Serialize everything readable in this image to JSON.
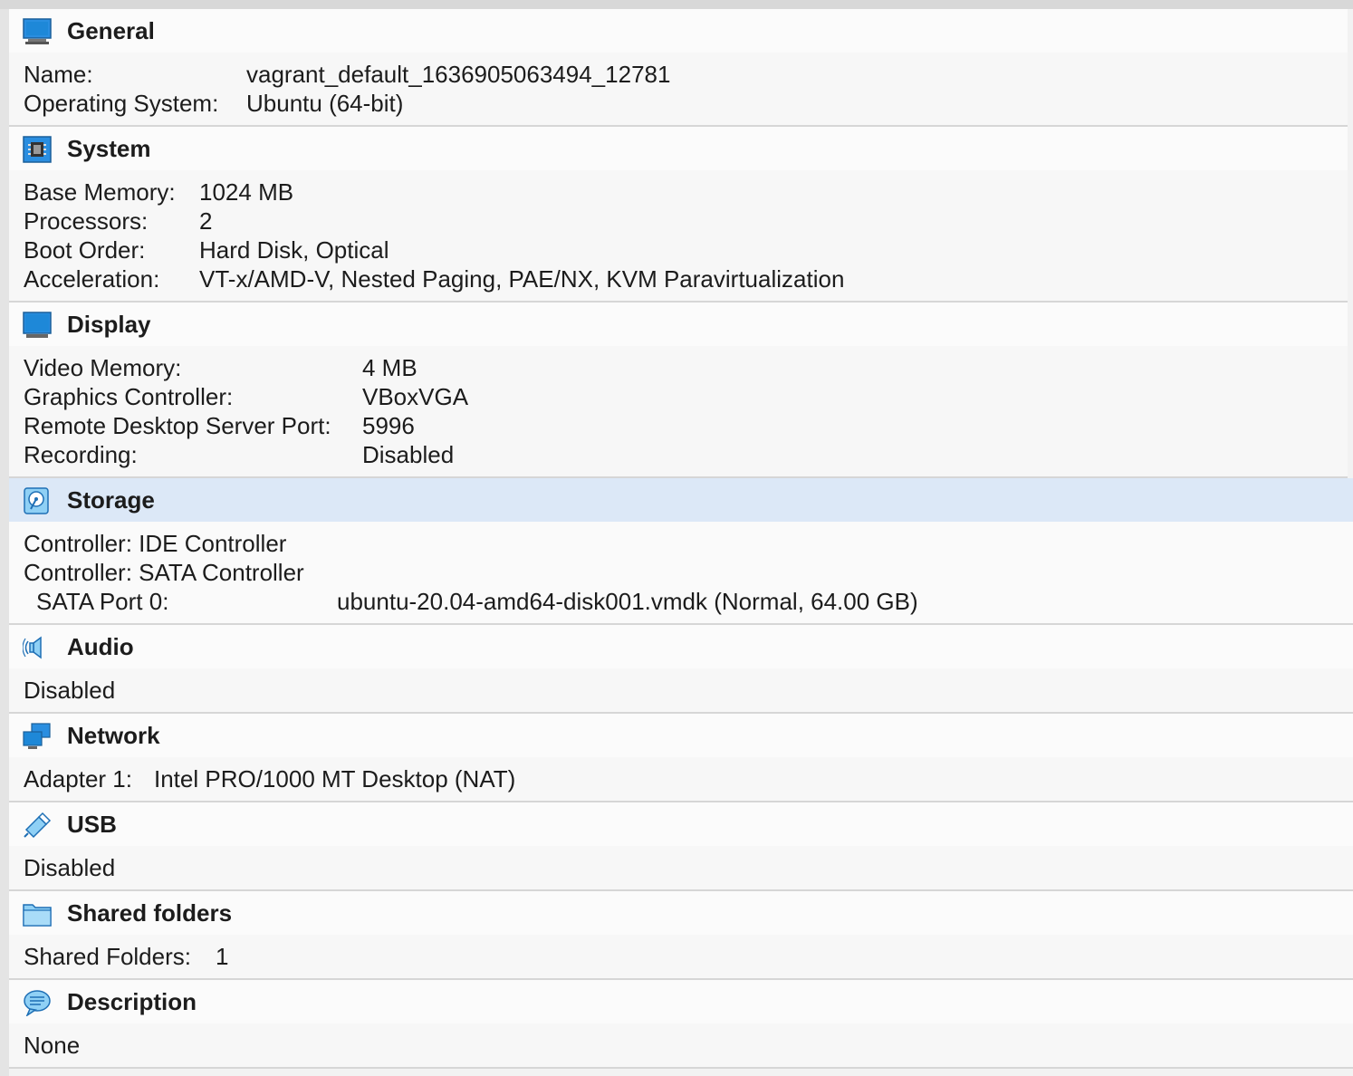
{
  "sections": {
    "general": {
      "title": "General",
      "rows": [
        {
          "key": "Name:",
          "value": "vagrant_default_1636905063494_12781"
        },
        {
          "key": "Operating System:",
          "value": "Ubuntu (64-bit)"
        }
      ]
    },
    "system": {
      "title": "System",
      "rows": [
        {
          "key": "Base Memory:",
          "value": "1024 MB"
        },
        {
          "key": "Processors:",
          "value": "2"
        },
        {
          "key": "Boot Order:",
          "value": "Hard Disk, Optical"
        },
        {
          "key": "Acceleration:",
          "value": "VT-x/AMD-V, Nested Paging, PAE/NX, KVM Paravirtualization"
        }
      ]
    },
    "display": {
      "title": "Display",
      "rows": [
        {
          "key": "Video Memory:",
          "value": "4 MB"
        },
        {
          "key": "Graphics Controller:",
          "value": "VBoxVGA"
        },
        {
          "key": "Remote Desktop Server Port:",
          "value": "5996"
        },
        {
          "key": "Recording:",
          "value": "Disabled"
        }
      ]
    },
    "storage": {
      "title": "Storage",
      "controller_ide": "Controller: IDE Controller",
      "controller_sata": "Controller: SATA Controller",
      "port_key": "SATA Port 0:",
      "port_value": "ubuntu-20.04-amd64-disk001.vmdk (Normal, 64.00 GB)"
    },
    "audio": {
      "title": "Audio",
      "value": "Disabled"
    },
    "network": {
      "title": "Network",
      "key": "Adapter 1:",
      "value": "Intel PRO/1000 MT Desktop (NAT)"
    },
    "usb": {
      "title": "USB",
      "value": "Disabled"
    },
    "shared_folders": {
      "title": "Shared folders",
      "key": "Shared Folders:",
      "value": "1"
    },
    "description": {
      "title": "Description",
      "value": "None"
    }
  },
  "colors": {
    "icon_blue": "#1e88d8",
    "icon_light": "#8fd0f5",
    "selected_header": "#dce8f7"
  }
}
